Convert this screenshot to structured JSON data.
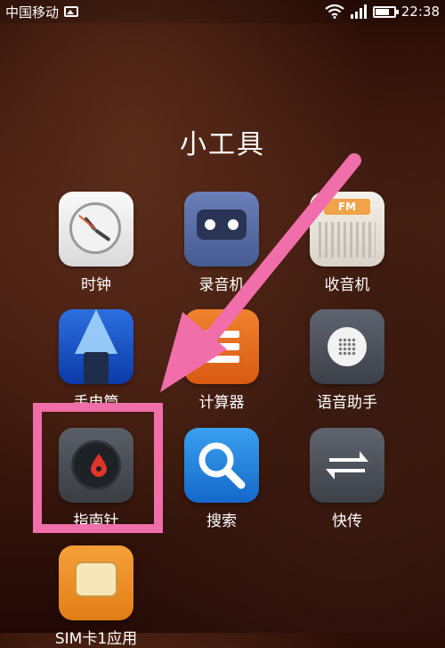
{
  "status_bar": {
    "carrier": "中国移动",
    "time": "22:38",
    "battery_level": 0.75,
    "icons": [
      "image-notification-icon",
      "wifi-icon",
      "signal-icon",
      "battery-icon"
    ]
  },
  "folder": {
    "title": "小工具",
    "apps": [
      {
        "label": "时钟",
        "icon": "clock-icon"
      },
      {
        "label": "录音机",
        "icon": "recorder-icon"
      },
      {
        "label": "收音机",
        "icon": "radio-icon",
        "badge": "FM"
      },
      {
        "label": "手电筒",
        "icon": "flashlight-icon"
      },
      {
        "label": "计算器",
        "icon": "calculator-icon"
      },
      {
        "label": "语音助手",
        "icon": "voice-assistant-icon"
      },
      {
        "label": "指南针",
        "icon": "compass-icon"
      },
      {
        "label": "搜索",
        "icon": "search-icon"
      },
      {
        "label": "快传",
        "icon": "quick-transfer-icon"
      },
      {
        "label": "SIM卡1应用",
        "icon": "sim-card-icon"
      }
    ]
  },
  "annotation": {
    "color": "#f06eaa",
    "highlighted_app": "指南针"
  }
}
